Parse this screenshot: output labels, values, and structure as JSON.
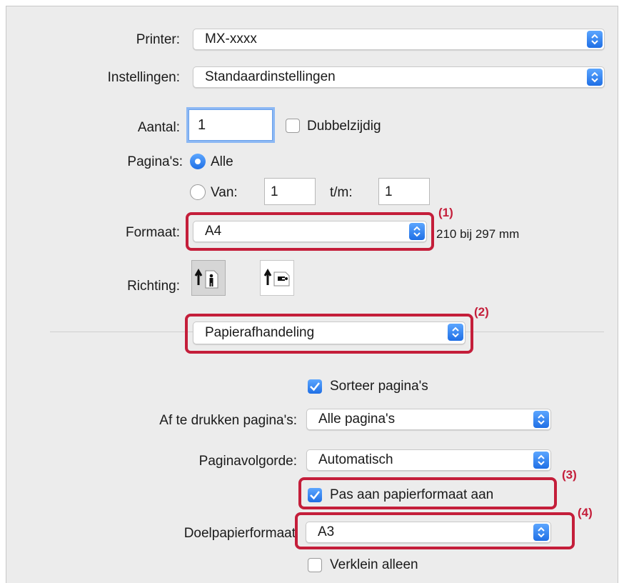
{
  "printer": {
    "label": "Printer:",
    "value": "MX-xxxx"
  },
  "presets": {
    "label": "Instellingen:",
    "value": "Standaardinstellingen"
  },
  "copies": {
    "label": "Aantal:",
    "value": "1",
    "duplex_label": "Dubbelzijdig",
    "duplex_checked": false
  },
  "pages": {
    "label": "Pagina's:",
    "all_label": "Alle",
    "from_label": "Van:",
    "from_value": "1",
    "to_label": "t/m:",
    "to_value": "1",
    "selected": "Alle"
  },
  "paper_size": {
    "label": "Formaat:",
    "value": "A4",
    "dimensions": "210 bij 297 mm"
  },
  "orientation": {
    "label": "Richting:",
    "selected": "portrait",
    "icons": [
      "portrait-orientation-icon",
      "landscape-orientation-icon"
    ]
  },
  "section_popup": {
    "value": "Papierafhandeling"
  },
  "paper_handling": {
    "collate_label": "Sorteer pagina's",
    "collate_checked": true,
    "pages_to_print_label": "Af te drukken pagina's:",
    "pages_to_print_value": "Alle pagina's",
    "page_order_label": "Paginavolgorde:",
    "page_order_value": "Automatisch",
    "scale_label": "Pas aan papierformaat aan",
    "scale_checked": true,
    "dest_label": "Doelpapierformaat",
    "dest_value": "A3",
    "scale_down_label": "Verklein alleen",
    "scale_down_checked": false
  },
  "annotations": [
    "(1)",
    "(2)",
    "(3)",
    "(4)"
  ],
  "colors": {
    "highlight": "#c41e3a",
    "accent": "#1f6fe5"
  }
}
